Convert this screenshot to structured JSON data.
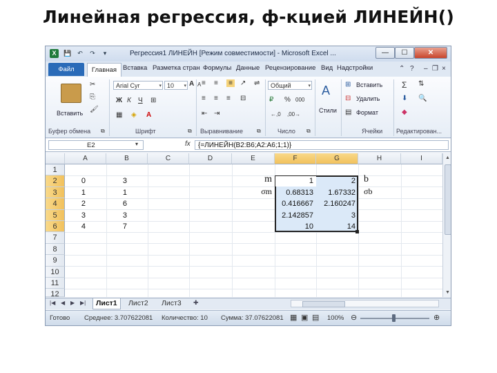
{
  "slide_title": "Линейная регрессия, ф-кцией ЛИНЕЙН()",
  "window": {
    "title": "Регрессия1 ЛИНЕЙН  [Режим совместимости] - Microsoft Excel ...",
    "app_icon": "X",
    "minimize": "—",
    "maximize": "☐",
    "close": "✕"
  },
  "quick_access": {
    "save_icon": "💾",
    "undo_icon": "↶",
    "redo_icon": "↷",
    "customize_icon": "▾"
  },
  "tabs": {
    "file": "Файл",
    "home": "Главная",
    "items": [
      "Вставка",
      "Разметка стран",
      "Формулы",
      "Данные",
      "Рецензирование",
      "Вид",
      "Надстройки"
    ]
  },
  "ribbon": {
    "clipboard": {
      "paste_label": "Вставить",
      "group_label": "Буфер обмена"
    },
    "font": {
      "name": "Arial Cyr",
      "size": "10",
      "group_label": "Шрифт",
      "bold": "Ж",
      "italic": "К",
      "underline": "Ч",
      "grow": "A",
      "shrink": "A"
    },
    "alignment": {
      "group_label": "Выравнивание"
    },
    "number": {
      "format": "Общий",
      "percent": "%",
      "thousands": "000",
      "group_label": "Число"
    },
    "styles": {
      "label": "Стили"
    },
    "cells": {
      "insert": "Вставить",
      "delete": "Удалить",
      "format": "Формат",
      "group_label": "Ячейки"
    },
    "editing": {
      "sum": "Σ",
      "group_label": "Редактирован..."
    }
  },
  "formula_bar": {
    "name_box": "E2",
    "fx": "fx",
    "formula": "{=ЛИНЕЙН(B2:B6;A2:A6;1;1)}"
  },
  "grid": {
    "columns": [
      "A",
      "B",
      "C",
      "D",
      "E",
      "F",
      "G",
      "H",
      "I"
    ],
    "selected_columns": [
      "F",
      "G"
    ],
    "rows": [
      "1",
      "2",
      "3",
      "4",
      "5",
      "6",
      "7",
      "8",
      "9",
      "10",
      "11",
      "12"
    ],
    "selected_rows": [
      "2",
      "3",
      "4",
      "5",
      "6"
    ],
    "cells": {
      "A2": "0",
      "B2": "3",
      "A3": "1",
      "B3": "1",
      "A4": "2",
      "B4": "6",
      "A5": "3",
      "B5": "3",
      "A6": "4",
      "B6": "7",
      "E2": "m",
      "E3": "σm",
      "F2": "1",
      "G2": "2",
      "F3": "0.68313",
      "G3": "1.67332",
      "F4": "0.416667",
      "G4": "2.160247",
      "F5": "2.142857",
      "G5": "3",
      "F6": "10",
      "G6": "14",
      "H2": "b",
      "H3": "σb"
    }
  },
  "sheets": {
    "tabs": [
      "Лист1",
      "Лист2",
      "Лист3"
    ],
    "active": "Лист1"
  },
  "status_bar": {
    "ready": "Готово",
    "average": "Среднее: 3.707622081",
    "count": "Количество: 10",
    "sum": "Сумма: 37.07622081",
    "zoom": "100%",
    "zoom_out": "⊖",
    "zoom_in": "⊕"
  }
}
